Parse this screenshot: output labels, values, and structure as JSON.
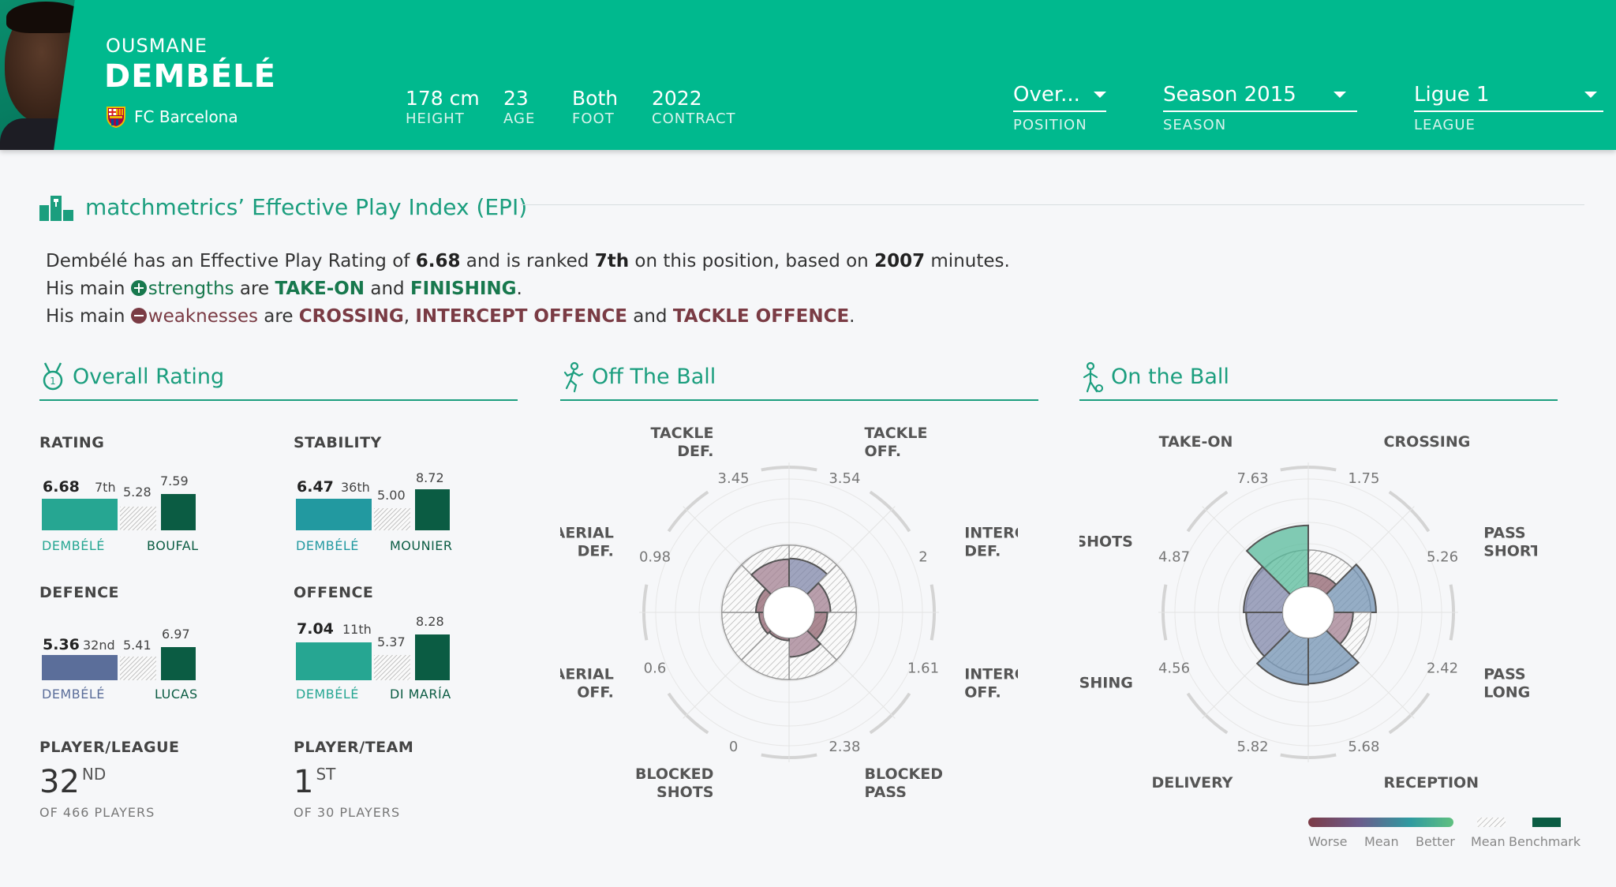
{
  "header": {
    "first_name": "OUSMANE",
    "last_name": "DEMBÉLÉ",
    "club": "FC Barcelona",
    "stats": [
      {
        "value": "178 cm",
        "label": "HEIGHT"
      },
      {
        "value": "23",
        "label": "AGE"
      },
      {
        "value": "Both",
        "label": "FOOT"
      },
      {
        "value": "2022",
        "label": "CONTRACT"
      }
    ],
    "position": {
      "value": "Over...",
      "label": "POSITION"
    },
    "season": {
      "value": "Season 2015",
      "label": "SEASON"
    },
    "league": {
      "value": "Ligue 1",
      "label": "LEAGUE"
    },
    "colors": {
      "brand": "#00b98e"
    }
  },
  "epi": {
    "title": "matchmetrics’ Effective Play Index (EPI)",
    "line1_a": "Dembélé has an Effective Play Rating of ",
    "rating": "6.68",
    "line1_b": " and is ranked ",
    "rank": "7th",
    "line1_c": " on this position, based on ",
    "minutes": "2007",
    "line1_d": " minutes.",
    "line2_a": "His main ",
    "strengths_word": "strengths",
    "line2_b": " are ",
    "strength1": "TAKE-ON",
    "and": " and ",
    "strength2": "FINISHING",
    "period": ".",
    "line3_a": "His main ",
    "weaknesses_word": "weaknesses",
    "line3_b": " are ",
    "weak1": "CROSSING",
    "comma": ", ",
    "weak2": "INTERCEPT OFFENCE",
    "weak3": "TACKLE OFFENCE"
  },
  "sections": {
    "overall": "Overall Rating",
    "off_ball": "Off The Ball",
    "on_ball": "On the Ball"
  },
  "overall": {
    "rating": {
      "title": "RATING",
      "value": "6.68",
      "rank": "7th",
      "mean": "5.28",
      "bench": "7.59",
      "player": "DEMBÉLÉ",
      "bench_player": "BOUFAL"
    },
    "stability": {
      "title": "STABILITY",
      "value": "6.47",
      "rank": "36th",
      "mean": "5.00",
      "bench": "8.72",
      "player": "DEMBÉLÉ",
      "bench_player": "MOUNIER"
    },
    "defence": {
      "title": "DEFENCE",
      "value": "5.36",
      "rank": "32nd",
      "mean": "5.41",
      "bench": "6.97",
      "player": "DEMBÉLÉ",
      "bench_player": "LUCAS"
    },
    "offence": {
      "title": "OFFENCE",
      "value": "7.04",
      "rank": "11th",
      "mean": "5.37",
      "bench": "8.28",
      "player": "DEMBÉLÉ",
      "bench_player": "DI MARÍA"
    },
    "player_league": {
      "title": "PLAYER/LEAGUE",
      "rank": "32",
      "suffix": "ND",
      "of": "OF 466 PLAYERS"
    },
    "player_team": {
      "title": "PLAYER/TEAM",
      "rank": "1",
      "suffix": "ST",
      "of": "OF 30 PLAYERS"
    }
  },
  "chart_data": [
    {
      "type": "polar-bar",
      "title": "Off The Ball",
      "categories": [
        "TACKLE OFF.",
        "INTERCEPT DEF.",
        "INTERCEPT OFF.",
        "BLOCKED PASS",
        "BLOCKED SHOTS",
        "AERIAL OFF.",
        "AERIAL DEF.",
        "TACKLE DEF."
      ],
      "values": [
        3.54,
        2,
        1.61,
        2.38,
        0,
        0.6,
        0.98,
        3.45
      ]
    },
    {
      "type": "polar-bar",
      "title": "On the Ball",
      "categories": [
        "CROSSING",
        "PASS SHORT",
        "PASS LONG",
        "RECEPTION",
        "DELIVERY",
        "FINISHING",
        "SHOTS",
        "TAKE-ON"
      ],
      "values": [
        1.75,
        5.26,
        2.42,
        5.68,
        5.82,
        4.56,
        4.87,
        7.63
      ]
    }
  ],
  "legend": {
    "worse": "Worse",
    "mean": "Mean",
    "better": "Better",
    "mean2": "Mean",
    "benchmark": "Benchmark"
  }
}
